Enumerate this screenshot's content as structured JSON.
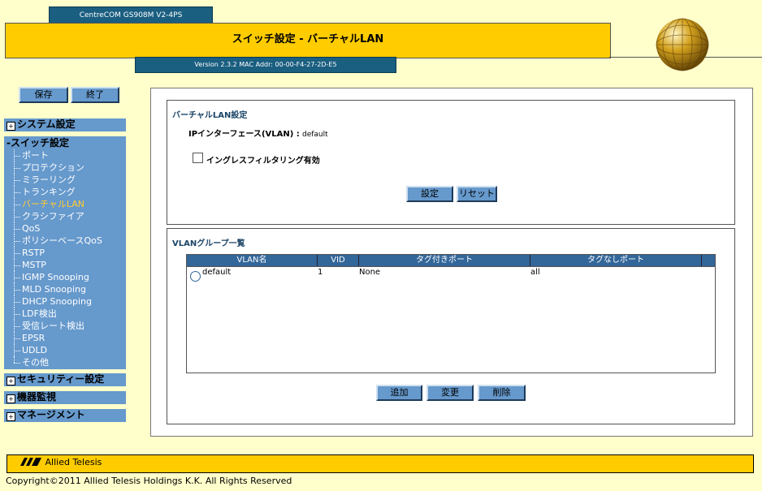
{
  "header": {
    "model": "CentreCOM GS908M V2-4PS",
    "title": "スイッチ設定 - バーチャルLAN",
    "version": "Version 2.3.2 MAC Addr: 00-00-F4-27-2D-E5"
  },
  "toolbar": {
    "save": "保存",
    "exit": "終了"
  },
  "sidebar": {
    "system": "システム設定",
    "switch": "スイッチ設定",
    "switch_items": [
      "ポート",
      "プロテクション",
      "ミラーリング",
      "トランキング",
      "バーチャルLAN",
      "クラシファイア",
      "QoS",
      "ポリシーベースQoS",
      "RSTP",
      "MSTP",
      "IGMP Snooping",
      "MLD Snooping",
      "DHCP Snooping",
      "LDF検出",
      "受信レート検出",
      "EPSR",
      "UDLD",
      "その他"
    ],
    "security": "セキュリティー設定",
    "monitor": "機器監視",
    "management": "マネージメント",
    "expand_symbol": "+",
    "collapse_symbol": "-"
  },
  "vlan_settings": {
    "title": "バーチャルLAN設定",
    "ip_interface_label": "IPインターフェース(VLAN) :",
    "ip_interface_value": "default",
    "ingress_filter_label": "イングレスフィルタリング有効",
    "ingress_filter_checked": false,
    "set_button": "設定",
    "reset_button": "リセット"
  },
  "vlan_group": {
    "title": "VLANグループ一覧",
    "columns": [
      "VLAN名",
      "VID",
      "タグ付きポート",
      "タグなしポート"
    ],
    "rows": [
      {
        "name": "default",
        "vid": "1",
        "tagged": "None",
        "untagged": "all"
      }
    ],
    "add_button": "追加",
    "edit_button": "変更",
    "delete_button": "削除"
  },
  "footer": {
    "brand": "Allied Telesis",
    "copyright": "Copyright©2011 Allied Telesis Holdings K.K. All Rights Reserved"
  },
  "colors": {
    "accent_yellow": "#ffcc00",
    "nav_blue": "#6699cc",
    "header_blue": "#1a5e80",
    "active_item": "#ffcc33"
  }
}
